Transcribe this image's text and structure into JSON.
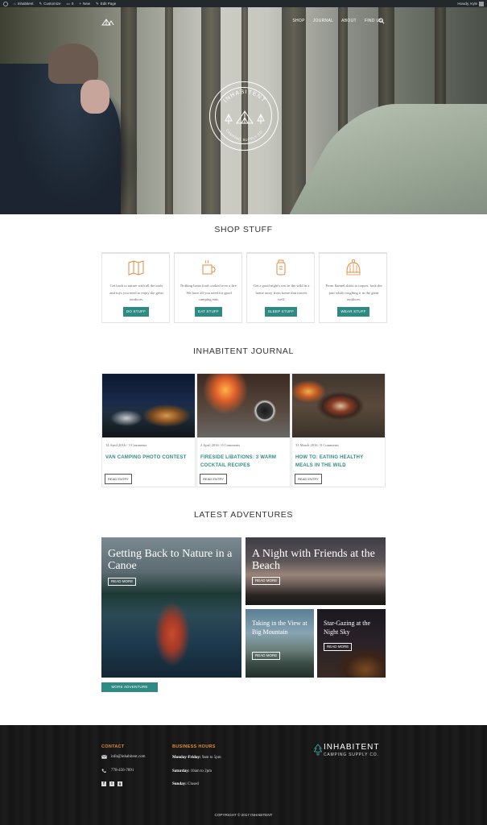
{
  "admin_bar": {
    "items": [
      "Inhabitent",
      "Customize",
      "0",
      "New",
      "Edit Page"
    ],
    "greeting": "Howdy, Kyle"
  },
  "nav": {
    "items": [
      "SHOP",
      "JOURNAL",
      "ABOUT",
      "FIND US"
    ]
  },
  "hero": {
    "badge_top": "INHABITENT",
    "badge_bottom": "CAMPING SUPPLY CO."
  },
  "shop": {
    "title": "SHOP STUFF",
    "cards": [
      {
        "icon": "map-icon",
        "text": "Get back to nature with all the tools and toys you need to enjoy the great outdoors.",
        "button": "DO STUFF"
      },
      {
        "icon": "mug-icon",
        "text": "Nothing beats food cooked over a fire. We have all you need for good camping eats.",
        "button": "EAT STUFF"
      },
      {
        "icon": "lantern-icon",
        "text": "Get a good night's rest in the wild in a home away from home that travels well.",
        "button": "SLEEP STUFF"
      },
      {
        "icon": "beanie-icon",
        "text": "From flannel shirts to toques, look the part while roughing it in the great outdoors.",
        "button": "WEAR STUFF"
      }
    ]
  },
  "journal": {
    "title": "INHABITENT JOURNAL",
    "posts": [
      {
        "meta": "14 April 2016 / 3 Comments",
        "title": "VAN CAMPING PHOTO CONTEST",
        "button": "READ ENTRY"
      },
      {
        "meta": "2 April 2016 / 0 Comments",
        "title": "FIRESIDE LIBATIONS: 3 WARM COCKTAIL RECIPES",
        "button": "READ ENTRY"
      },
      {
        "meta": "31 March 2016 / 0 Comments",
        "title": "HOW TO: EATING HEALTHY MEALS IN THE WILD",
        "button": "READ ENTRY"
      }
    ]
  },
  "adventures": {
    "title": "LATEST ADVENTURES",
    "items": [
      {
        "title": "Getting Back to Nature in a Canoe",
        "button": "READ MORE"
      },
      {
        "title": "A Night with Friends at the Beach",
        "button": "READ MORE"
      },
      {
        "title": "Taking in the View at Big Mountain",
        "button": "READ MORE"
      },
      {
        "title": "Star-Gazing at the Night Sky",
        "button": "READ MORE"
      }
    ],
    "more_button": "MORE ADVENTURE"
  },
  "footer": {
    "contact_heading": "CONTACT",
    "email": "info@inhabitent.com",
    "phone": "778-456-7891",
    "hours_heading": "BUSINESS HOURS",
    "hours": [
      {
        "day": "Monday-Friday:",
        "time": "9am to 5pm"
      },
      {
        "day": "Saturday:",
        "time": "10am to 2pm"
      },
      {
        "day": "Sunday:",
        "time": "Closed"
      }
    ],
    "brand": "INHABITENT",
    "brand_sub": "CAMPING SUPPLY CO.",
    "copyright": "COPYRIGHT © 2017 INHABITENT"
  },
  "colors": {
    "accent": "#2e8b84",
    "icon_orange": "#e08a3c",
    "footer_bg": "#181818"
  }
}
